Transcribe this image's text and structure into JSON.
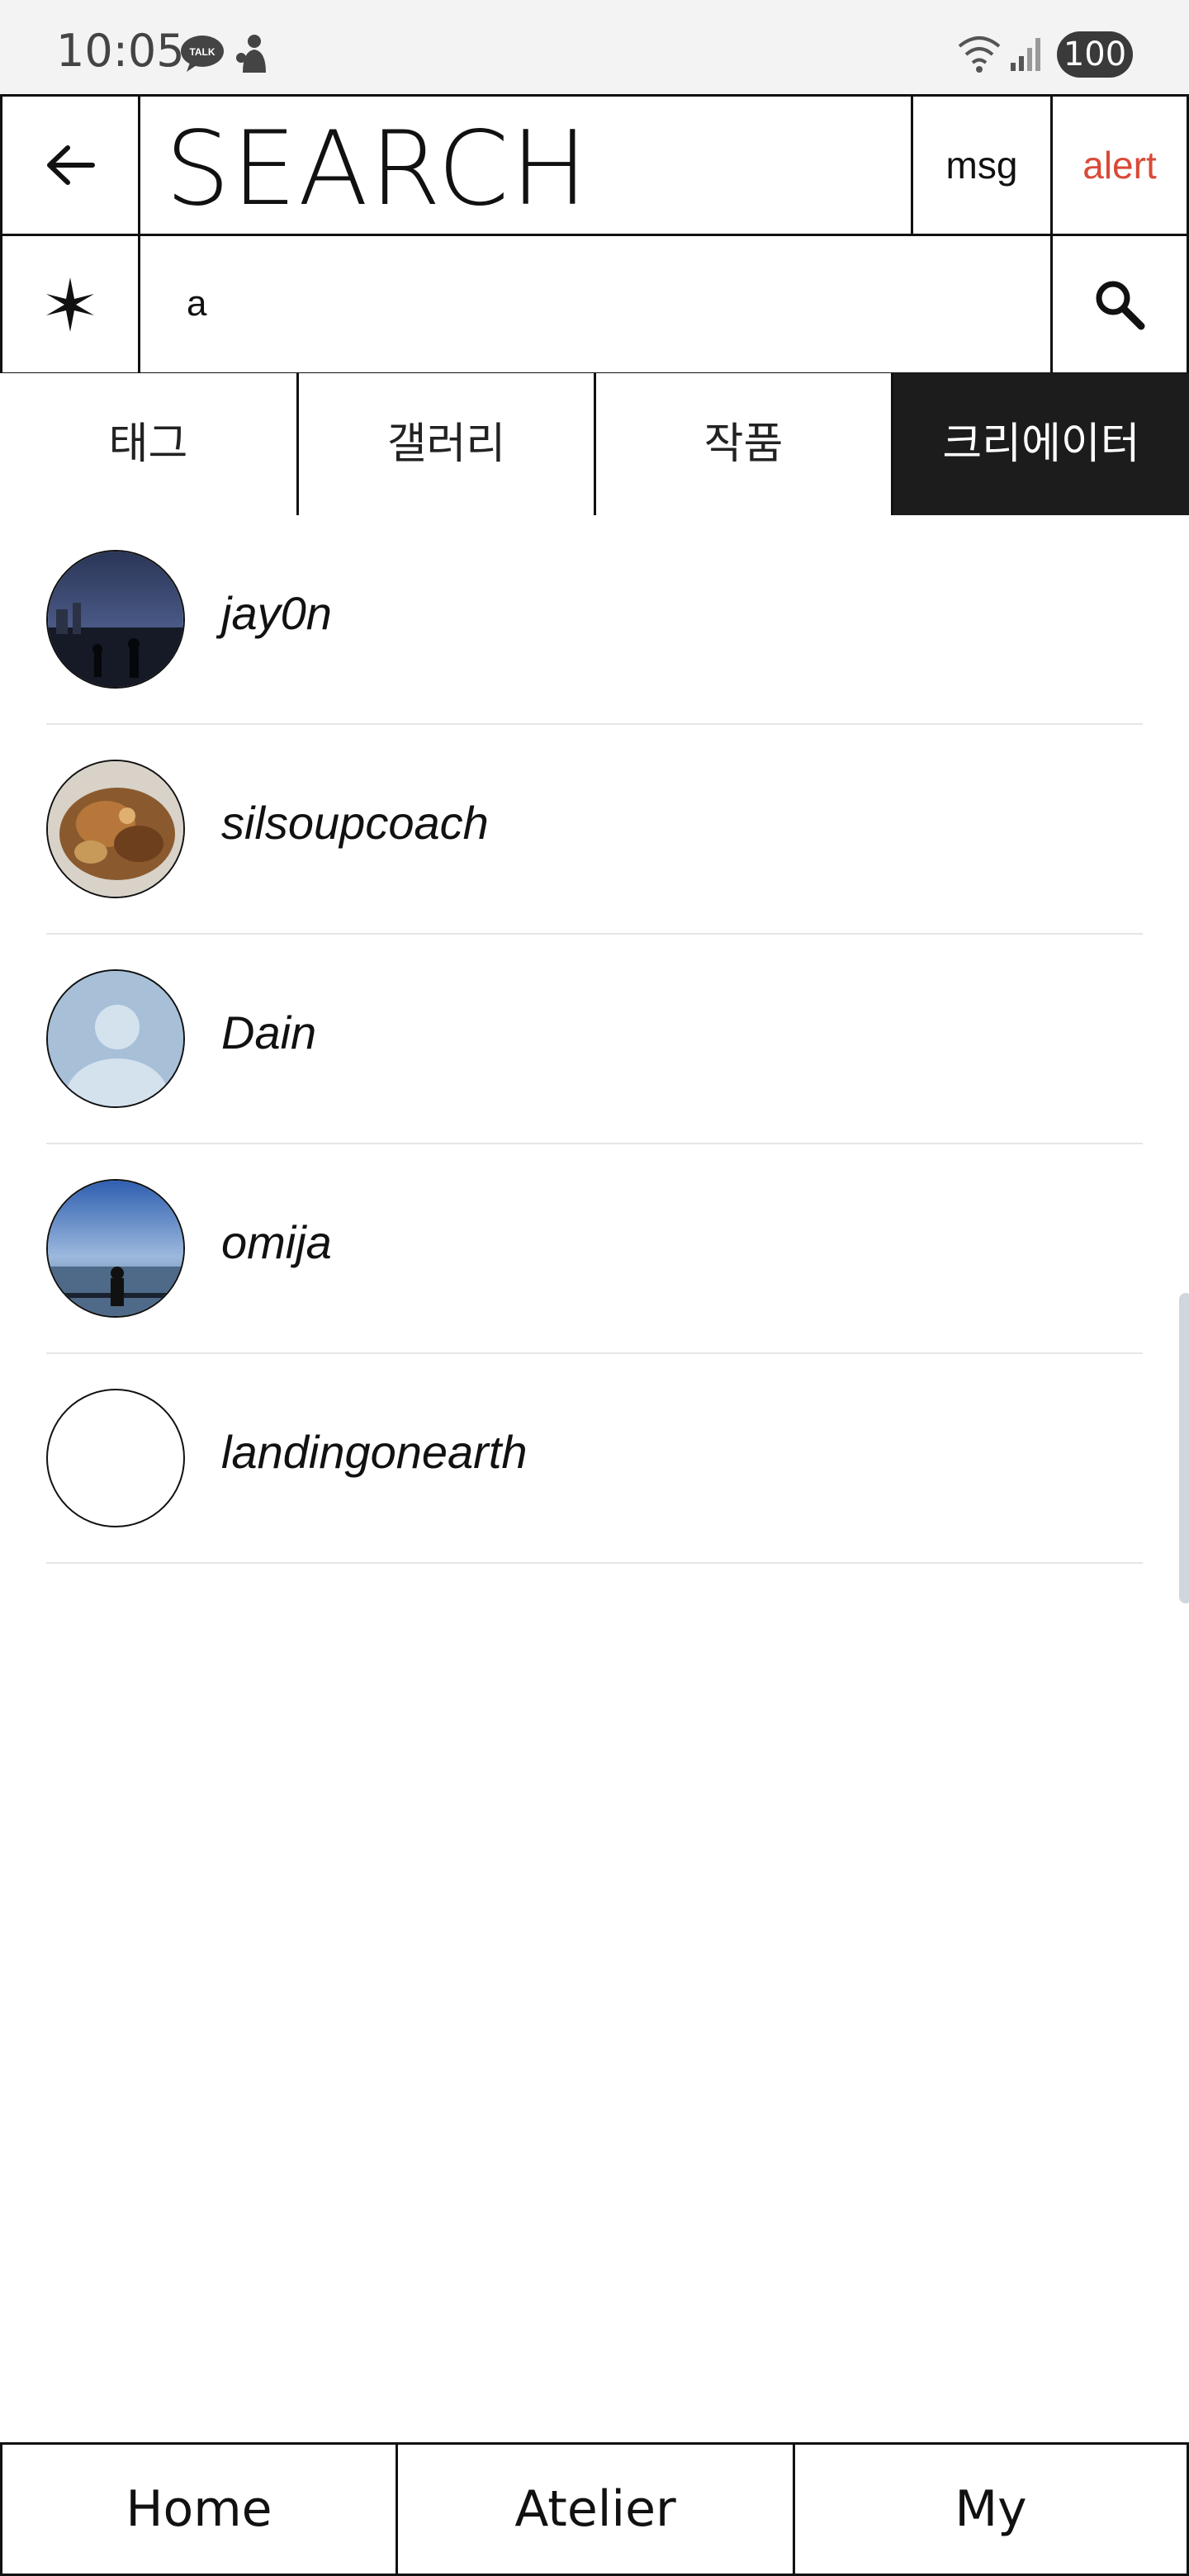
{
  "status_bar": {
    "time": "10:05",
    "talk_badge": "TALK",
    "battery": "100",
    "icons": [
      "kakaotalk-icon",
      "person-notification-icon",
      "wifi-icon",
      "signal-icon",
      "battery-icon"
    ]
  },
  "header": {
    "title": "SEARCH",
    "msg_label": "msg",
    "alert_label": "alert",
    "alert_color": "#d94a38",
    "back_icon": "arrow-left-icon",
    "star_icon": "asterisk-star-icon",
    "search_icon": "search-icon"
  },
  "search": {
    "value": "a",
    "placeholder": ""
  },
  "tabs": [
    {
      "label": "태그",
      "active": false
    },
    {
      "label": "갤러리",
      "active": false
    },
    {
      "label": "작품",
      "active": false
    },
    {
      "label": "크리에이터",
      "active": true
    }
  ],
  "creators": [
    {
      "name": "jay0n",
      "avatar": "night-city-photo"
    },
    {
      "name": "silsoupcoach",
      "avatar": "food-photo"
    },
    {
      "name": "Dain",
      "avatar": "default-person"
    },
    {
      "name": "omija",
      "avatar": "seaside-silhouette-photo"
    },
    {
      "name": "landingonearth",
      "avatar": "empty"
    }
  ],
  "bottom_nav": [
    {
      "label": "Home"
    },
    {
      "label": "Atelier"
    },
    {
      "label": "My"
    }
  ],
  "colors": {
    "active_tab_bg": "#1c1c1c",
    "border": "#111111",
    "status_bar_bg": "#f3f3f3"
  }
}
